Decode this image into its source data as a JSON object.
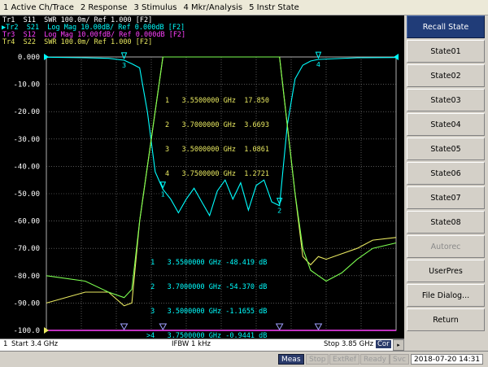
{
  "menu": [
    "1 Active Ch/Trace",
    "2 Response",
    "3 Stimulus",
    "4 Mkr/Analysis",
    "5 Instr State"
  ],
  "traces": [
    {
      "text": "Tr1  S11  SWR 100.0m/ Ref 1.000 [F2]",
      "color": "#ffffff"
    },
    {
      "text": "Tr2  S21  Log Mag 10.00dB/ Ref 0.000dB [F2]",
      "color": "#00ffff",
      "active": "▶"
    },
    {
      "text": "Tr3  S12  Log Mag 10.00fdB/ Ref 0.000dB [F2]",
      "color": "#ff40ff"
    },
    {
      "text": "Tr4  S22  SWR 100.0m/ Ref 1.000 [F2]",
      "color": "#e8e860"
    }
  ],
  "marker_table_upper": [
    "1   3.5500000 GHz  17.850",
    "2   3.7000000 GHz  3.6693",
    "3   3.5000000 GHz  1.0861",
    "4   3.7500000 GHz  1.2721"
  ],
  "marker_table_lower": [
    " 1   3.5500000 GHz -48.419 dB",
    " 2   3.7000000 GHz -54.370 dB",
    " 3   3.5000000 GHz -1.1655 dB",
    ">4   3.7500000 GHz -0.9441 dB"
  ],
  "softkeys": {
    "title": "Recall State",
    "items": [
      "State01",
      "State02",
      "State03",
      "State04",
      "State05",
      "State06",
      "State07",
      "State08"
    ],
    "autorec": "Autorec",
    "userpres": "UserPres",
    "filedialog": "File Dialog...",
    "return": "Return"
  },
  "channel_bar": {
    "channel": "1",
    "start": "Start 3.4 GHz",
    "ifbw": "IFBW 1 kHz",
    "stop": "Stop 3.85 GHz",
    "cor": "Cor"
  },
  "status_bar": {
    "meas": "Meas",
    "stop": "Stop",
    "extref": "ExtRef",
    "ready": "Ready",
    "svc": "Svc",
    "datetime": "2018-07-20 14:31"
  },
  "colors": {
    "tr1": "#ffffff",
    "tr2": "#00ffff",
    "tr3": "#ff40ff",
    "tr4": "#e8e860",
    "s11_trace": "#e8e860",
    "s22_trace": "#7cff50",
    "grid": "#8a8a8a"
  },
  "chart_data": {
    "type": "line",
    "x_start_ghz": 3.4,
    "x_stop_ghz": 3.85,
    "ylim": [
      -100,
      0
    ],
    "ytick_labels": [
      "0.000",
      "-10.00",
      "-20.00",
      "-30.00",
      "-40.00",
      "-50.00",
      "-60.00",
      "-70.00",
      "-80.00",
      "-90.00",
      "-100.0"
    ],
    "grid": true,
    "series": [
      {
        "trace": "S21",
        "x": [
          3.4,
          3.45,
          3.48,
          3.5,
          3.51,
          3.52,
          3.53,
          3.54,
          3.55,
          3.56,
          3.57,
          3.58,
          3.59,
          3.6,
          3.61,
          3.62,
          3.63,
          3.64,
          3.65,
          3.66,
          3.67,
          3.68,
          3.69,
          3.7,
          3.71,
          3.72,
          3.73,
          3.74,
          3.75,
          3.8,
          3.85
        ],
        "y": [
          -0.1,
          -0.3,
          -0.5,
          -1.2,
          -2.5,
          -4,
          -20,
          -42,
          -48.4,
          -52,
          -57,
          -52,
          -48,
          -53,
          -58,
          -49,
          -45,
          -52,
          -46,
          -56,
          -47,
          -45,
          -53,
          -54.4,
          -25,
          -8,
          -3,
          -1.5,
          -0.9,
          -0.3,
          -0.2
        ]
      },
      {
        "trace": "S11",
        "x": [
          3.4,
          3.45,
          3.48,
          3.5,
          3.51,
          3.52,
          3.55,
          3.7,
          3.72,
          3.73,
          3.74,
          3.75,
          3.76,
          3.78,
          3.8,
          3.82,
          3.85
        ],
        "y": [
          -90,
          -86,
          -86,
          -91,
          -90,
          -60,
          0,
          0,
          -50,
          -73,
          -76,
          -73,
          -74,
          -72,
          -70,
          -67,
          -66
        ]
      },
      {
        "trace": "S22",
        "x": [
          3.4,
          3.45,
          3.48,
          3.5,
          3.51,
          3.52,
          3.55,
          3.7,
          3.72,
          3.73,
          3.74,
          3.75,
          3.76,
          3.78,
          3.8,
          3.82,
          3.85
        ],
        "y": [
          -80,
          -82,
          -86,
          -88,
          -85,
          -60,
          0,
          0,
          -50,
          -70,
          -78,
          -80,
          -82,
          -79,
          -74,
          -70,
          -68
        ]
      }
    ],
    "markers": [
      {
        "id": "1",
        "x": 3.55,
        "s21": -48.419,
        "swr": 17.85
      },
      {
        "id": "2",
        "x": 3.7,
        "s21": -54.37,
        "swr": 3.6693
      },
      {
        "id": "3",
        "x": 3.5,
        "s21": -1.1655,
        "swr": 1.0861
      },
      {
        "id": "4",
        "x": 3.75,
        "s21": -0.9441,
        "swr": 1.2721
      }
    ]
  }
}
